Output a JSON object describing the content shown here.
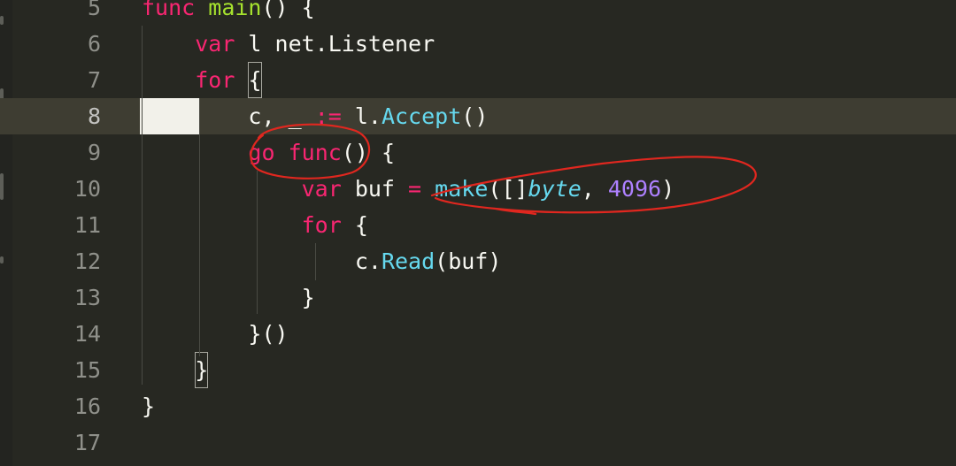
{
  "editor": {
    "lines": [
      {
        "number": "5",
        "indent": "",
        "tokens": [
          {
            "text": "func",
            "cls": "kw"
          },
          {
            "text": " "
          },
          {
            "text": "main",
            "cls": "fn"
          },
          {
            "text": "() {"
          }
        ]
      },
      {
        "number": "6",
        "indent": "    ",
        "tokens": [
          {
            "text": "var",
            "cls": "kw"
          },
          {
            "text": " l net.Listener"
          }
        ]
      },
      {
        "number": "7",
        "indent": "    ",
        "tokens": [
          {
            "text": "for",
            "cls": "kw"
          },
          {
            "text": " "
          },
          {
            "text": "{",
            "cls": "bracket-box"
          }
        ]
      },
      {
        "number": "8",
        "indent": "        ",
        "current": true,
        "tokens": [
          {
            "text": "c, _ "
          },
          {
            "text": ":=",
            "cls": "kw"
          },
          {
            "text": " l."
          },
          {
            "text": "Accept",
            "cls": "call"
          },
          {
            "text": "()"
          }
        ]
      },
      {
        "number": "9",
        "indent": "        ",
        "tokens": [
          {
            "text": "go",
            "cls": "kw"
          },
          {
            "text": " "
          },
          {
            "text": "func",
            "cls": "kw"
          },
          {
            "text": "() {"
          }
        ]
      },
      {
        "number": "10",
        "indent": "            ",
        "tokens": [
          {
            "text": "var",
            "cls": "kw"
          },
          {
            "text": " buf "
          },
          {
            "text": "=",
            "cls": "kw"
          },
          {
            "text": " "
          },
          {
            "text": "make",
            "cls": "call"
          },
          {
            "text": "([]"
          },
          {
            "text": "byte",
            "cls": "type"
          },
          {
            "text": ", "
          },
          {
            "text": "4096",
            "cls": "num"
          },
          {
            "text": ")"
          }
        ]
      },
      {
        "number": "11",
        "indent": "            ",
        "tokens": [
          {
            "text": "for",
            "cls": "kw"
          },
          {
            "text": " {"
          }
        ]
      },
      {
        "number": "12",
        "indent": "                ",
        "tokens": [
          {
            "text": "c."
          },
          {
            "text": "Read",
            "cls": "call"
          },
          {
            "text": "(buf)"
          }
        ]
      },
      {
        "number": "13",
        "indent": "            ",
        "tokens": [
          {
            "text": "}"
          }
        ]
      },
      {
        "number": "14",
        "indent": "        ",
        "tokens": [
          {
            "text": "}()"
          }
        ]
      },
      {
        "number": "15",
        "indent": "    ",
        "tokens": [
          {
            "text": "}",
            "cls": "bracket-box"
          }
        ]
      },
      {
        "number": "16",
        "indent": "",
        "tokens": [
          {
            "text": "}"
          }
        ]
      },
      {
        "number": "17",
        "indent": "",
        "tokens": []
      }
    ]
  },
  "colors": {
    "background": "#272822",
    "current_line": "#3e3d32",
    "keyword": "#f92672",
    "function_name": "#a6e22e",
    "builtin_call": "#66d9ef",
    "number": "#ae81ff",
    "plain_text": "#f8f8f2",
    "line_number": "#8f908a",
    "annotation_ink": "#e0271f"
  },
  "annotations": [
    {
      "kind": "circle",
      "target": "go func"
    },
    {
      "kind": "circle",
      "target": "= make([]byte, 4096)"
    }
  ]
}
